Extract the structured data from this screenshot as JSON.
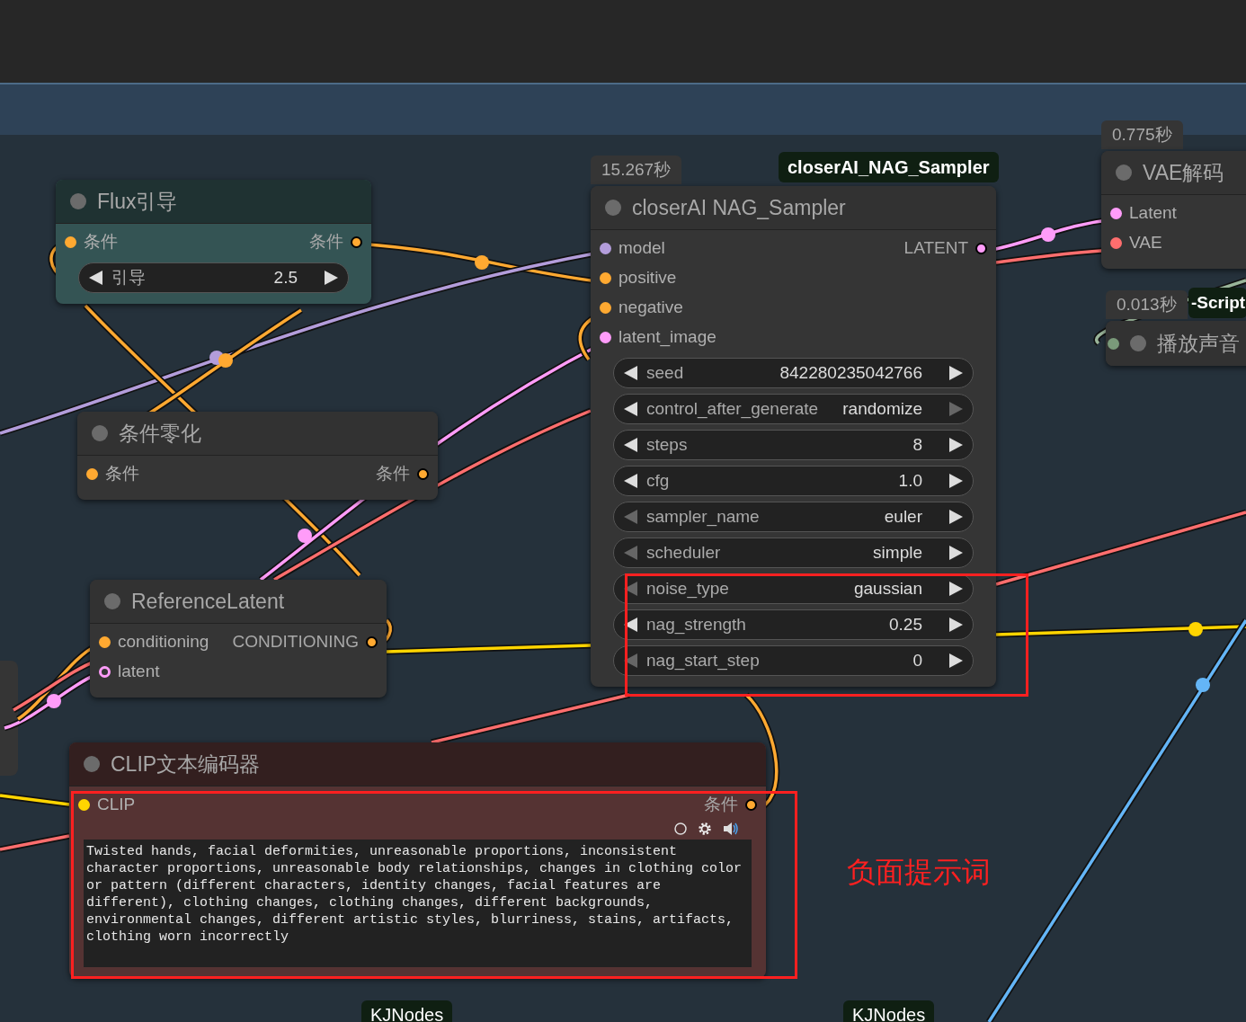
{
  "nodes": [
    {
      "title": "Flux引导",
      "color": "#345454",
      "inputs": [
        {
          "label": "条件",
          "color": "#ffa931"
        }
      ],
      "outputs": [
        {
          "label": "条件",
          "color": "#ffa931"
        }
      ],
      "widgets": [
        {
          "label": "引导",
          "value": "2.5",
          "prev_disabled": false,
          "next_disabled": false
        }
      ]
    },
    {
      "title": "条件零化",
      "color": "#353535",
      "inputs": [
        {
          "label": "条件",
          "color": "#ffa931"
        }
      ],
      "outputs": [
        {
          "label": "条件",
          "color": "#ffa931"
        }
      ]
    },
    {
      "title": "ReferenceLatent",
      "color": "#353535",
      "inputs": [
        {
          "label": "conditioning",
          "color": "#ffa931"
        },
        {
          "label": "latent",
          "color": "#ff9cf9",
          "optional": true
        }
      ],
      "outputs": [
        {
          "label": "CONDITIONING",
          "color": "#ffa931"
        }
      ]
    },
    {
      "title": "closerAI NAG_Sampler",
      "color": "#353535",
      "time_badge": "15.267秒",
      "title_badge": "closerAI_NAG_Sampler",
      "inputs": [
        {
          "label": "model",
          "color": "#b39ddb"
        },
        {
          "label": "positive",
          "color": "#ffa931"
        },
        {
          "label": "negative",
          "color": "#ffa931"
        },
        {
          "label": "latent_image",
          "color": "#ff9cf9"
        }
      ],
      "outputs": [
        {
          "label": "LATENT",
          "color": "#ff9cf9"
        }
      ],
      "widgets": [
        {
          "label": "seed",
          "value": "842280235042766",
          "prev_disabled": false,
          "next_disabled": false
        },
        {
          "label": "control_after_generate",
          "value": "randomize",
          "prev_disabled": false,
          "next_disabled": true
        },
        {
          "label": "steps",
          "value": "8",
          "prev_disabled": false,
          "next_disabled": false
        },
        {
          "label": "cfg",
          "value": "1.0",
          "prev_disabled": false,
          "next_disabled": false
        },
        {
          "label": "sampler_name",
          "value": "euler",
          "prev_disabled": true,
          "next_disabled": false
        },
        {
          "label": "scheduler",
          "value": "simple",
          "prev_disabled": true,
          "next_disabled": false
        },
        {
          "label": "noise_type",
          "value": "gaussian",
          "prev_disabled": true,
          "next_disabled": false
        },
        {
          "label": "nag_strength",
          "value": "0.25",
          "prev_disabled": false,
          "next_disabled": false
        },
        {
          "label": "nag_start_step",
          "value": "0",
          "prev_disabled": true,
          "next_disabled": false
        }
      ]
    },
    {
      "title": "VAE解码",
      "color": "#353535",
      "time_badge": "0.775秒",
      "inputs": [
        {
          "label": "Latent",
          "color": "#ff9cf9"
        },
        {
          "label": "VAE",
          "color": "#ff6e6e"
        }
      ]
    },
    {
      "title": "播放声音",
      "color": "#353535",
      "collapsed": true,
      "time_badge": "0.013秒",
      "title_badge": "-Script",
      "inputs": [
        {
          "color": "#7a9a7a"
        }
      ]
    },
    {
      "title": "CLIP文本编码器",
      "color": "#553333",
      "inputs": [
        {
          "label": "CLIP",
          "color": "#ffd500"
        }
      ],
      "outputs": [
        {
          "label": "条件",
          "color": "#ffa931"
        }
      ],
      "toolbar": true,
      "text": "Twisted hands, facial deformities, unreasonable proportions, inconsistent character proportions, unreasonable body relationships, changes in clothing color or pattern (different characters, identity changes, facial features are different), clothing changes, clothing changes, different backgrounds, environmental changes, different artistic styles, blurriness, stains, artifacts, clothing worn incorrectly"
    }
  ],
  "footer_badges": [
    "KJNodes",
    "KJNodes"
  ],
  "annotation": {
    "text": "负面提示词"
  }
}
